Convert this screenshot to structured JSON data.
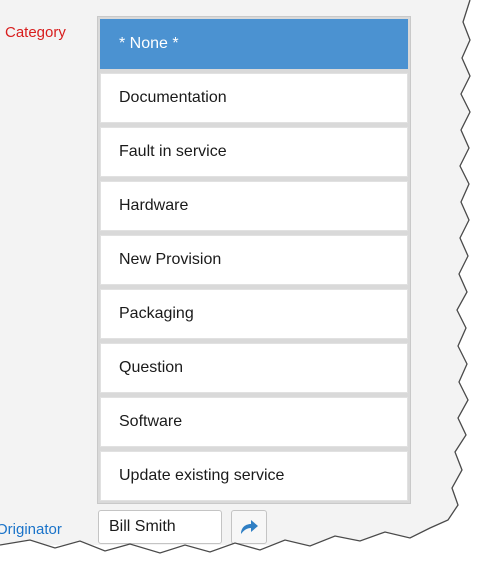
{
  "category": {
    "label": "Category",
    "options": [
      {
        "label": "* None *",
        "selected": true
      },
      {
        "label": "Documentation",
        "selected": false
      },
      {
        "label": "Fault in service",
        "selected": false
      },
      {
        "label": "Hardware",
        "selected": false
      },
      {
        "label": "New Provision",
        "selected": false
      },
      {
        "label": "Packaging",
        "selected": false
      },
      {
        "label": "Question",
        "selected": false
      },
      {
        "label": "Software",
        "selected": false
      },
      {
        "label": "Update existing service",
        "selected": false
      }
    ]
  },
  "originator": {
    "label": "Originator",
    "value": "Bill Smith"
  },
  "colors": {
    "category_label": "#d81e1e",
    "originator_label": "#1a73c9",
    "selected_bg": "#4b92d1",
    "share_icon": "#2f7fc4"
  },
  "icons": {
    "share": "share-arrow-icon"
  }
}
